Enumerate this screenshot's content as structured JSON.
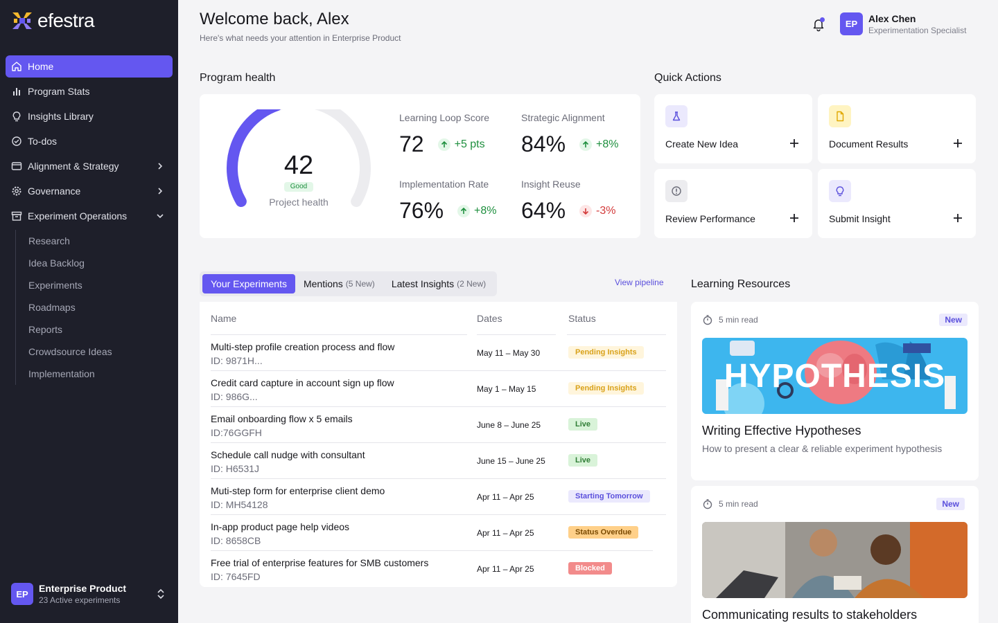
{
  "brand": {
    "name": "efestra"
  },
  "sidebar": {
    "items": [
      {
        "label": "Home",
        "icon": "home-icon",
        "active": true
      },
      {
        "label": "Program Stats",
        "icon": "bar-chart-icon"
      },
      {
        "label": "Insights Library",
        "icon": "lightbulb-icon"
      },
      {
        "label": "To-dos",
        "icon": "check-circle-icon"
      },
      {
        "label": "Alignment & Strategy",
        "icon": "browser-icon",
        "expandable": true
      },
      {
        "label": "Governance",
        "icon": "gear-icon",
        "expandable": true
      },
      {
        "label": "Experiment Operations",
        "icon": "archive-icon",
        "expanded": true
      }
    ],
    "subitems": [
      "Research",
      "Idea Backlog",
      "Experiments",
      "Roadmaps",
      "Reports",
      "Crowdsource Ideas",
      "Implementation"
    ],
    "workspace": {
      "initials": "EP",
      "name": "Enterprise Product",
      "sub": "23 Active experiments"
    }
  },
  "header": {
    "title": "Welcome back, Alex",
    "subtitle": "Here's what needs your attention in Enterprise Product",
    "user": {
      "initials": "EP",
      "name": "Alex Chen",
      "role": "Experimentation Specialist"
    }
  },
  "health": {
    "section_title": "Program health",
    "score": "42",
    "score_fraction": 0.42,
    "badge": "Good",
    "label": "Project health",
    "metrics": [
      {
        "label": "Learning Loop Score",
        "value": "72",
        "delta": "+5 pts",
        "dir": "up"
      },
      {
        "label": "Strategic Alignment",
        "value": "84%",
        "delta": "+8%",
        "dir": "up"
      },
      {
        "label": "Implementation Rate",
        "value": "76%",
        "delta": "+8%",
        "dir": "up"
      },
      {
        "label": "Insight Reuse",
        "value": "64%",
        "delta": "-3%",
        "dir": "down"
      }
    ]
  },
  "quick_actions": {
    "section_title": "Quick Actions",
    "items": [
      {
        "label": "Create New Idea",
        "icon": "flask-icon",
        "color": "#ebe9fd"
      },
      {
        "label": "Document Results",
        "icon": "document-icon",
        "color": "#fff4c2"
      },
      {
        "label": "Review Performance",
        "icon": "info-circle-icon",
        "color": "#ececef"
      },
      {
        "label": "Submit Insight",
        "icon": "lightbulb-icon",
        "color": "#ebe9fd"
      }
    ]
  },
  "tabs": {
    "items": [
      {
        "label": "Your Experiments",
        "count": ""
      },
      {
        "label": "Mentions",
        "count": "(5 New)"
      },
      {
        "label": "Latest Insights",
        "count": "(2 New)"
      }
    ],
    "view_pipeline": "View pipeline"
  },
  "experiments": {
    "columns": [
      "Name",
      "Dates",
      "Status"
    ],
    "rows": [
      {
        "name": "Multi-step profile creation process and flow",
        "id": "ID: 9871H...",
        "dates": "May 11 – May 30",
        "status": "Pending Insights",
        "kind": "pending"
      },
      {
        "name": "Credit card capture in account sign up flow",
        "id": "ID: 986G...",
        "dates": "May 1 – May 15",
        "status": "Pending Insights",
        "kind": "pending"
      },
      {
        "name": "Email onboarding flow x 5 emails",
        "id": "ID:76GGFH",
        "dates": "June 8 – June 25",
        "status": "Live",
        "kind": "live"
      },
      {
        "name": "Schedule call nudge with consultant",
        "id": "ID: H6531J",
        "dates": "June 15 – June 25",
        "status": "Live",
        "kind": "live"
      },
      {
        "name": "Muti-step form for enterprise client demo",
        "id": "ID: MH54128",
        "dates": "Apr 11 – Apr 25",
        "status": "Starting Tomorrow",
        "kind": "tomorrow"
      },
      {
        "name": "In-app product page help videos",
        "id": "ID: 8658CB",
        "dates": "Apr 11 – Apr 25",
        "status": "Status Overdue",
        "kind": "overdue"
      },
      {
        "name": "Free trial of enterprise features for SMB customers",
        "id": "ID: 7645FD",
        "dates": "Apr 11 – Apr 25",
        "status": "Blocked",
        "kind": "blocked"
      }
    ]
  },
  "resources": {
    "section_title": "Learning Resources",
    "items": [
      {
        "read": "5 min read",
        "badge": "New",
        "image_text": "HYPOTHESIS",
        "title": "Writing Effective Hypotheses",
        "desc": "How to present a clear & reliable experiment hypothesis"
      },
      {
        "read": "5 min read",
        "badge": "New",
        "title": "Communicating results to stakeholders",
        "desc": ""
      }
    ]
  }
}
